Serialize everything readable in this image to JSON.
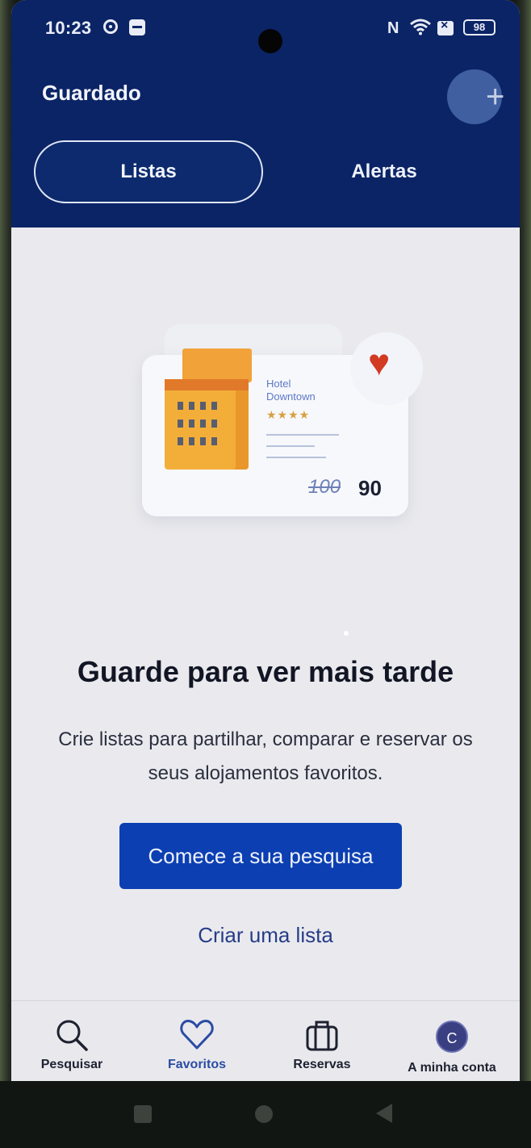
{
  "status_bar": {
    "time": "10:23",
    "battery": "98"
  },
  "header": {
    "title": "Guardado",
    "tabs": [
      {
        "label": "Listas"
      },
      {
        "label": "Alertas"
      }
    ]
  },
  "illustration": {
    "hotel_name": "Hotel Downtown",
    "stars": "★★★★",
    "price_old": "100",
    "price_new": "90"
  },
  "empty_state": {
    "title": "Guarde para ver mais tarde",
    "description": "Crie listas para partilhar, comparar e reservar os seus alojamentos favoritos.",
    "primary_button": "Comece a sua pesquisa",
    "secondary_link": "Criar uma lista"
  },
  "bottom_nav": {
    "items": [
      {
        "label": "Pesquisar",
        "icon": "search-icon"
      },
      {
        "label": "Favoritos",
        "icon": "heart-icon"
      },
      {
        "label": "Reservas",
        "icon": "briefcase-icon"
      },
      {
        "label": "A minha conta",
        "icon": "avatar",
        "avatar_letter": "C"
      }
    ]
  },
  "colors": {
    "header_bg": "#0b2466",
    "primary_button": "#0c3fb2",
    "link": "#273d87",
    "heart": "#d23a22"
  }
}
